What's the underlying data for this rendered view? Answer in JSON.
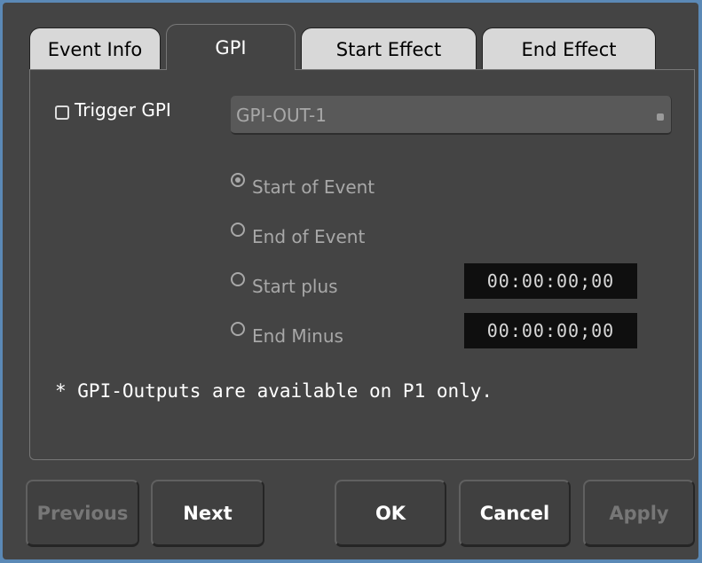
{
  "tabs": {
    "event_info": "Event Info",
    "gpi": "GPI",
    "start_effect": "Start Effect",
    "end_effect": "End Effect",
    "active": "GPI"
  },
  "gpi": {
    "trigger_label": "Trigger GPI",
    "trigger_checked": false,
    "output_value": "GPI-OUT-1",
    "options": [
      {
        "label": "Start of Event",
        "selected": true
      },
      {
        "label": "End of Event",
        "selected": false
      },
      {
        "label": "Start plus",
        "selected": false
      },
      {
        "label": "End Minus",
        "selected": false
      }
    ],
    "start_plus_time": "00:00:00;00",
    "end_minus_time": "00:00:00;00",
    "note": "* GPI-Outputs are available on P1 only."
  },
  "buttons": {
    "previous": "Previous",
    "next": "Next",
    "ok": "OK",
    "cancel": "Cancel",
    "apply": "Apply"
  },
  "colors": {
    "window_bg": "#444444",
    "frame": "#5b89b6",
    "inactive_tab": "#d8d8d8",
    "timecode_bg": "#0f0f0f"
  }
}
